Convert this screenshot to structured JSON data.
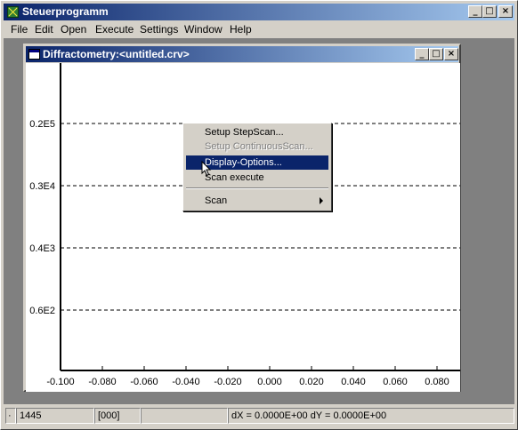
{
  "app": {
    "title": "Steuerprogramm",
    "buttons": {
      "minimize": "_",
      "maximize": "□",
      "close": "×"
    }
  },
  "menubar": [
    {
      "label": "File"
    },
    {
      "label": "Edit"
    },
    {
      "label": "Open"
    },
    {
      "label": "Execute"
    },
    {
      "label": "Settings"
    },
    {
      "label": "Window"
    },
    {
      "label": "Help"
    }
  ],
  "child_window": {
    "title": "Diffractometry:<untitled.crv>"
  },
  "chart_data": {
    "type": "line",
    "title": "",
    "xlabel": "",
    "ylabel": "",
    "x_ticks": [
      "-0.100",
      "-0.080",
      "-0.060",
      "-0.040",
      "-0.020",
      "0.000",
      "0.020",
      "0.040",
      "0.060",
      "0.080"
    ],
    "y_ticks": [
      "0.2E5",
      "0.3E4",
      "0.4E3",
      "0.6E2"
    ],
    "xlim": [
      -0.1,
      0.1
    ],
    "grid": "dashed horizontal",
    "series": []
  },
  "context_menu": {
    "items": [
      {
        "label": "Setup StepScan...",
        "enabled": true,
        "selected": false
      },
      {
        "label": "Setup ContinuousScan...",
        "enabled": false,
        "selected": false
      },
      {
        "label": "Display-Options...",
        "enabled": true,
        "selected": true
      },
      {
        "label": "Scan execute",
        "enabled": true,
        "selected": false
      },
      {
        "label": "Scan",
        "enabled": true,
        "selected": false,
        "submenu": true
      }
    ]
  },
  "statusbar": {
    "c0": "·",
    "c1": "1445",
    "c2": "[000]",
    "c3": "",
    "c4": "dX = 0.0000E+00  dY = 0.0000E+00"
  },
  "colors": {
    "titlebar": "#0a246a",
    "face": "#d4d0c8",
    "selection": "#0a246a"
  }
}
